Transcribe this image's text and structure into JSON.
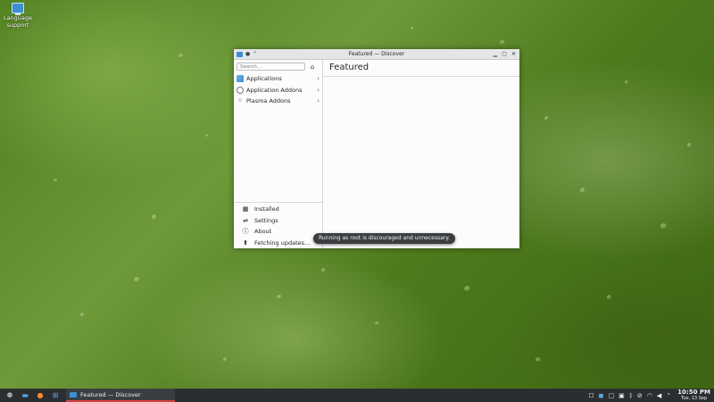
{
  "desktop": {
    "icon_label": "Language support"
  },
  "window": {
    "title": "Featured — Discover",
    "search_placeholder": "Search...",
    "categories": [
      {
        "label": "Applications",
        "icon": "applications-icon"
      },
      {
        "label": "Application Addons",
        "icon": "addons-icon"
      },
      {
        "label": "Plasma Addons",
        "icon": "plasma-icon"
      }
    ],
    "bottom_nav": [
      {
        "label": "Installed",
        "icon": "installed-icon"
      },
      {
        "label": "Settings",
        "icon": "settings-icon"
      },
      {
        "label": "About",
        "icon": "info-icon"
      },
      {
        "label": "Fetching updates...",
        "icon": "updates-icon"
      }
    ],
    "page_title": "Featured"
  },
  "toast": {
    "message": "Running as root is discouraged and unnecessary."
  },
  "taskbar": {
    "task_label": "Featured — Discover",
    "clock_time": "10:50 PM",
    "clock_date": "Tue, 13 Sep"
  },
  "colors": {
    "accent": "#3d8fd1",
    "task_indicator": "#d93f3f",
    "panel": "#2b2e31"
  }
}
